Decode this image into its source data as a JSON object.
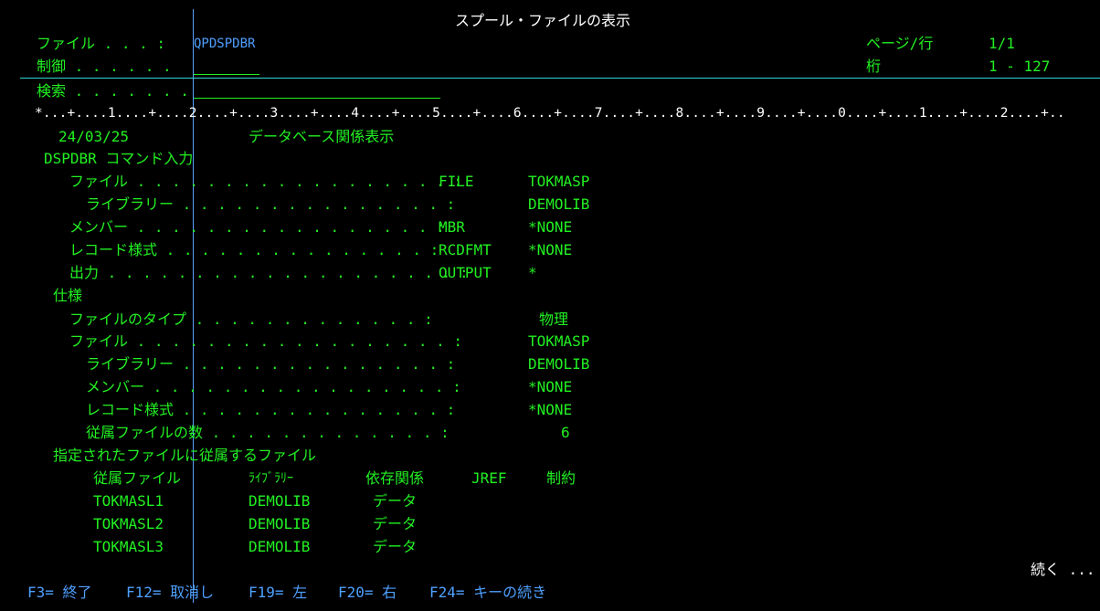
{
  "header": {
    "title": "スプール・ファイルの表示",
    "file_label": "ファイル . . . :",
    "file_value": "QPDSPDBR",
    "control_label": "制御 . . . . . .",
    "control_value": "",
    "page_label": "ページ/行",
    "page_value": "1/1",
    "column_label": "桁",
    "column_value": "1 - 127",
    "search_label": "検索 . . . . . . .",
    "search_value": ""
  },
  "ruler": "*...+....1....+....2....+....3....+....4....+....5....+....6....+....7....+....8....+....9....+....0....+....1....+....2....+..",
  "report": {
    "date": "24/03/25",
    "heading": "データベース関係表示",
    "command_section": "DSPDBR コマンド入力",
    "command_rows": [
      {
        "label": "ファイル . . . . . . . . . . . . . . . . . . :",
        "keyword": "FILE",
        "value": "TOKMASP"
      },
      {
        "label": "ライブラリー . . . . . . . . . . . . . . . :",
        "keyword": "",
        "value": "DEMOLIB"
      },
      {
        "label": "メンバー . . . . . . . . . . . . . . . . . :",
        "keyword": "MBR",
        "value": "*NONE"
      },
      {
        "label": "レコード様式 . . . . . . . . . . . . . . . :",
        "keyword": "RCDFMT",
        "value": "*NONE"
      },
      {
        "label": "出力 . . . . . . . . . . . . . . . . . . . . :",
        "keyword": "OUTPUT",
        "value": "*"
      }
    ],
    "spec_section": "仕様",
    "spec_rows": [
      {
        "label": "ファイルのタイプ . . . . . . . . . . . . . :",
        "value": "物理"
      },
      {
        "label": "ファイル . . . . . . . . . . . . . . . . . . :",
        "value": "TOKMASP"
      },
      {
        "label": "ライブラリー . . . . . . . . . . . . . . . :",
        "value": "DEMOLIB"
      },
      {
        "label": "メンバー . . . . . . . . . . . . . . . . . :",
        "value": "*NONE"
      },
      {
        "label": "レコード様式 . . . . . . . . . . . . . . . :",
        "value": "*NONE"
      },
      {
        "label": "従属ファイルの数 . . . . . . . . . . . . . :",
        "value": "6"
      }
    ],
    "dependent_section": "指定されたファイルに従属するファイル",
    "dependent_columns": [
      "従属ファイル",
      "ﾗｲﾌﾞﾗﾘｰ",
      "依存関係",
      "JREF",
      "制約"
    ],
    "dependent_rows": [
      {
        "file": "TOKMASL1",
        "library": "DEMOLIB",
        "dependency": "データ"
      },
      {
        "file": "TOKMASL2",
        "library": "DEMOLIB",
        "dependency": "データ"
      },
      {
        "file": "TOKMASL3",
        "library": "DEMOLIB",
        "dependency": "データ"
      }
    ]
  },
  "more_indicator": "続く ...",
  "function_keys": [
    {
      "label": "F3= 終了"
    },
    {
      "label": "F12= 取消し"
    },
    {
      "label": "F19= 左"
    },
    {
      "label": "F20= 右"
    },
    {
      "label": "F24= キーの続き"
    }
  ],
  "colors": {
    "background": "#000000",
    "text_green": "#22f022",
    "text_white": "#ffffff",
    "text_blue": "#4ea0ff",
    "separator_cyan": "#33d6d6"
  }
}
